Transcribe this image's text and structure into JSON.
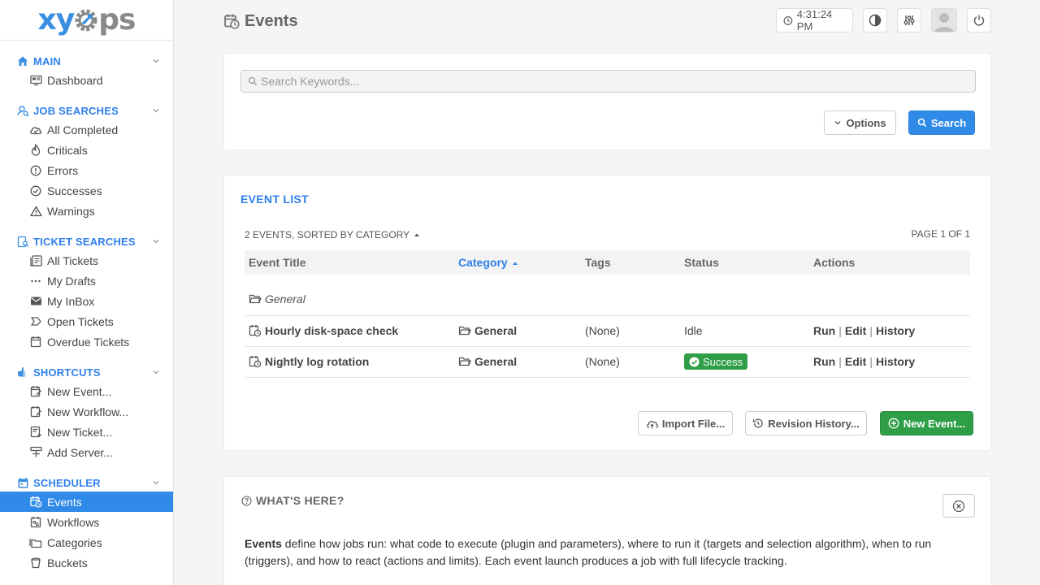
{
  "app": {
    "logo_left": "xy",
    "logo_right": "ps"
  },
  "sidebar": {
    "sections": [
      {
        "title": "MAIN",
        "icon": "home-icon",
        "items": [
          {
            "label": "Dashboard",
            "icon": "dashboard-icon"
          }
        ]
      },
      {
        "title": "JOB SEARCHES",
        "icon": "job-search-icon",
        "items": [
          {
            "label": "All Completed",
            "icon": "cloud-check-icon"
          },
          {
            "label": "Criticals",
            "icon": "fire-icon"
          },
          {
            "label": "Errors",
            "icon": "alert-circle-icon"
          },
          {
            "label": "Successes",
            "icon": "check-circle-icon"
          },
          {
            "label": "Warnings",
            "icon": "warning-icon"
          }
        ]
      },
      {
        "title": "TICKET SEARCHES",
        "icon": "ticket-search-icon",
        "items": [
          {
            "label": "All Tickets",
            "icon": "tickets-icon"
          },
          {
            "label": "My Drafts",
            "icon": "dots-icon"
          },
          {
            "label": "My InBox",
            "icon": "inbox-icon"
          },
          {
            "label": "Open Tickets",
            "icon": "label-icon"
          },
          {
            "label": "Overdue Tickets",
            "icon": "calendar-icon"
          }
        ]
      },
      {
        "title": "SHORTCUTS",
        "icon": "pointer-icon",
        "items": [
          {
            "label": "New Event...",
            "icon": "calendar-edit-icon"
          },
          {
            "label": "New Workflow...",
            "icon": "workflow-edit-icon"
          },
          {
            "label": "New Ticket...",
            "icon": "ticket-add-icon"
          },
          {
            "label": "Add Server...",
            "icon": "server-add-icon"
          }
        ]
      },
      {
        "title": "SCHEDULER",
        "icon": "scheduler-icon",
        "items": [
          {
            "label": "Events",
            "icon": "calendar-clock-icon",
            "active": true
          },
          {
            "label": "Workflows",
            "icon": "workflow-icon"
          },
          {
            "label": "Categories",
            "icon": "folders-icon"
          },
          {
            "label": "Buckets",
            "icon": "bucket-icon"
          }
        ]
      }
    ]
  },
  "header": {
    "title": "Events",
    "time": "4:31:24 PM"
  },
  "search": {
    "placeholder": "Search Keywords...",
    "options_label": "Options",
    "search_label": "Search"
  },
  "event_list": {
    "title": "EVENT LIST",
    "meta": "2 EVENTS, SORTED BY CATEGORY",
    "page": "PAGE 1 OF 1",
    "columns": [
      "Event Title",
      "Category",
      "Tags",
      "Status",
      "Actions"
    ],
    "group_label": "General",
    "rows": [
      {
        "title": "Hourly disk-space check",
        "category": "General",
        "tags": "(None)",
        "status": "Idle"
      },
      {
        "title": "Nightly log rotation",
        "category": "General",
        "tags": "(None)",
        "status": "Success"
      }
    ],
    "action_labels": [
      "Run",
      "Edit",
      "History"
    ],
    "import_label": "Import File...",
    "revision_label": "Revision History...",
    "new_label": "New Event..."
  },
  "help": {
    "title": "WHAT'S HERE?",
    "bold_word": "Events",
    "text": " define how jobs run: what code to execute (plugin and parameters), where to run it (targets and selection algorithm), when to run (triggers), and how to react (actions and limits). Each event launch produces a job with full lifecycle tracking."
  },
  "colors": {
    "accent": "#2f80ed",
    "active_bg": "#2f8ae8",
    "success": "#2e9e47"
  }
}
